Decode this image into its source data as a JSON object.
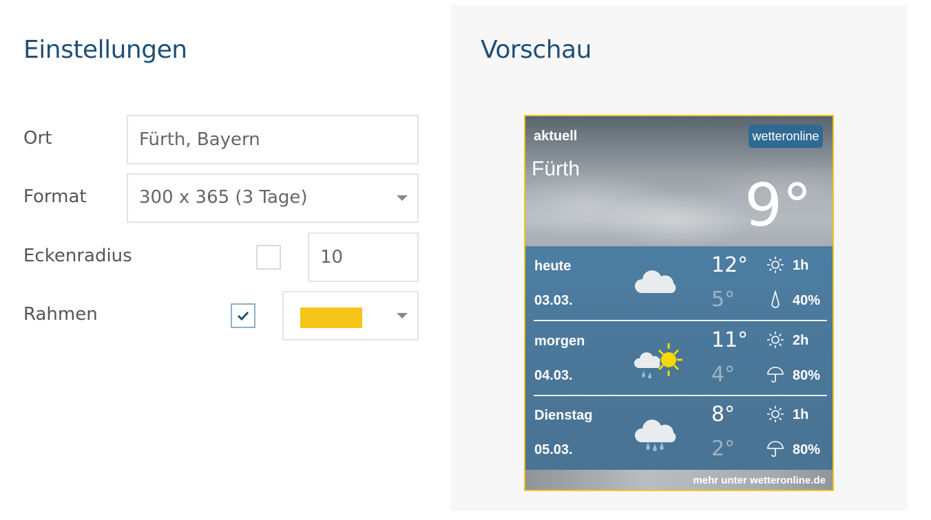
{
  "settings": {
    "title": "Einstellungen",
    "ort_label": "Ort",
    "ort_value": "Fürth, Bayern",
    "format_label": "Format",
    "format_value": "300 x 365 (3 Tage)",
    "eckenradius_label": "Eckenradius",
    "eckenradius_checked": false,
    "eckenradius_value": "10",
    "rahmen_label": "Rahmen",
    "rahmen_checked": true,
    "rahmen_color": "#f5c518"
  },
  "preview": {
    "title": "Vorschau",
    "widget": {
      "current_label": "aktuell",
      "logo_text": "wetteronline",
      "logo_accent_color": "#f5c518",
      "city": "Fürth",
      "current_temp": "9°",
      "border_color": "#f0c419",
      "days": [
        {
          "name": "heute",
          "date": "03.03.",
          "max": "12°",
          "min": "5°",
          "sun": "1h",
          "rain": "40%",
          "icon": "cloud-icon",
          "rain_icon": "raindrop-icon"
        },
        {
          "name": "morgen",
          "date": "04.03.",
          "max": "11°",
          "min": "4°",
          "sun": "2h",
          "rain": "80%",
          "icon": "sun-cloud-rain-icon",
          "rain_icon": "umbrella-icon"
        },
        {
          "name": "Dienstag",
          "date": "05.03.",
          "max": "8°",
          "min": "2°",
          "sun": "1h",
          "rain": "80%",
          "icon": "cloud-rain-icon",
          "rain_icon": "umbrella-icon"
        }
      ],
      "footer": "mehr unter wetteronline.de"
    }
  }
}
